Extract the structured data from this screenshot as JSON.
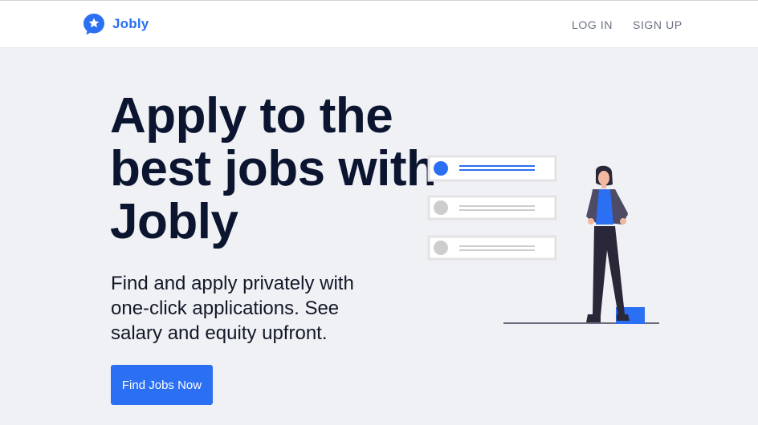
{
  "header": {
    "brand_name": "Jobly",
    "brand_icon": "star-chat-icon",
    "nav": {
      "login_label": "LOG IN",
      "signup_label": "SIGN UP"
    }
  },
  "hero": {
    "title": "Apply to the best jobs with Jobly",
    "subtitle": "Find and apply privately with one-click applications. See salary and equity upfront.",
    "cta_label": "Find Jobs Now"
  },
  "illustration": {
    "description_icon": "job-list-person-icon",
    "colors": {
      "accent": "#2b6ff2",
      "muted": "#cdcdcd",
      "card_border": "#e3e3e3",
      "figure_dark": "#2a2838"
    }
  }
}
